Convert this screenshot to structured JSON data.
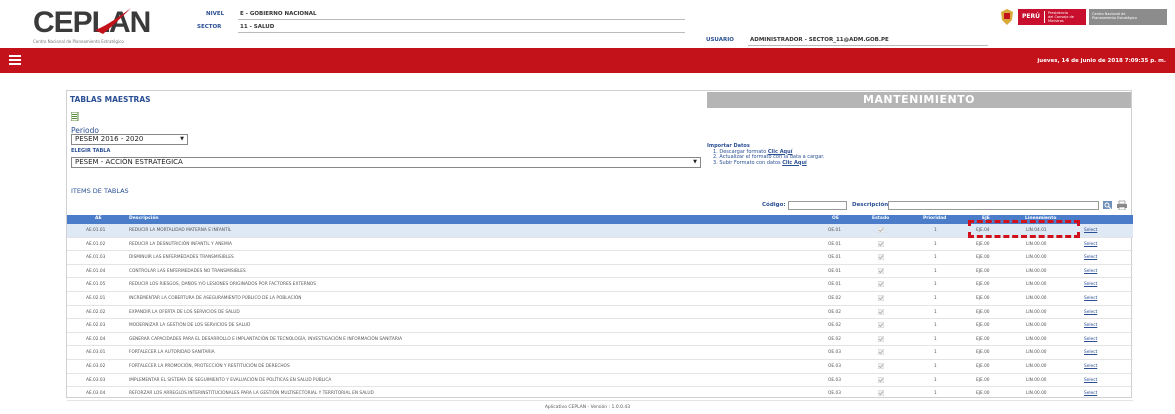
{
  "header": {
    "logo_text": "CEPLAN",
    "logo_sub": "Centro Nacional de Planeamiento Estratégico",
    "nivel_label": "NIVEL",
    "nivel_value": "E - GOBIERNO NACIONAL",
    "sector_label": "SECTOR",
    "sector_value": "11 - SALUD",
    "usuario_label": "USUARIO",
    "usuario_value": "ADMINISTRADOR - SECTOR_11@ADM.GOB.PE",
    "peru_word": "PERÚ",
    "peru_sub": "Presidencia\ndel Consejo de Ministros",
    "ceplan_box": "Centro Nacional de\nPlaneamiento Estratégico"
  },
  "menubar": {
    "datetime": "jueves, 14 de junio de 2018 7:09:35 p. m."
  },
  "panel": {
    "title": "TABLAS MAESTRAS",
    "mant_title": "MANTENIMIENTO",
    "periodo_label": "Periodo",
    "periodo_value": "PESEM 2016 - 2020",
    "elegir_label": "ELEGIR TABLA",
    "tabla_value": "PESEM - ACCIÓN ESTRATÉGICA",
    "import": {
      "title": "Importar Datos",
      "step1": "1. Descargar formato",
      "step1_link": "Clic Aquí",
      "step2": "2. Actualizar el formato con la data a cargar.",
      "step3": "3. Subir Formato con datos",
      "step3_link": "Clic Aquí"
    },
    "items_label": "ITEMS DE TABLAS",
    "codigo_label": "Código:",
    "descripcion_label": "Descripción:"
  },
  "grid": {
    "headers": {
      "ae": "AE",
      "descripcion": "Descripción",
      "oe": "OE",
      "estado": "Estado",
      "prioridad": "Prioridad",
      "eje": "EJE",
      "lineamiento": "Lineamiento"
    },
    "rows": [
      {
        "ae": "AE.01.01",
        "desc": "REDUCIR LA MORTALIDAD MATERNA E INFANTIL",
        "oe": "OE.01",
        "prio": "1",
        "eje": "EJE.04",
        "lin": "LIN.04.01",
        "action": "Select"
      },
      {
        "ae": "AE.01.02",
        "desc": "REDUCIR LA DESNUTRICIÓN INFANTIL Y ANEMIA",
        "oe": "OE.01",
        "prio": "1",
        "eje": "EJE.00",
        "lin": "LIN.00.00",
        "action": "Select"
      },
      {
        "ae": "AE.01.03",
        "desc": "DISMINUIR LAS ENFERMEDADES TRANSMISIBLES",
        "oe": "OE.01",
        "prio": "1",
        "eje": "EJE.00",
        "lin": "LIN.00.00",
        "action": "Select"
      },
      {
        "ae": "AE.01.04",
        "desc": "CONTROLAR LAS ENFERMEDADES NO TRANSMISIBLES",
        "oe": "OE.01",
        "prio": "1",
        "eje": "EJE.00",
        "lin": "LIN.00.00",
        "action": "Select"
      },
      {
        "ae": "AE.01.05",
        "desc": "REDUCIR LOS RIESGOS, DAÑOS Y/O LESIONES ORIGINADOS POR FACTORES EXTERNOS",
        "oe": "OE.01",
        "prio": "1",
        "eje": "EJE.00",
        "lin": "LIN.00.00",
        "action": "Select"
      },
      {
        "ae": "AE.02.01",
        "desc": "INCREMENTAR LA COBERTURA DE ASEGURAMIENTO PÚBLICO DE LA POBLACIÓN",
        "oe": "OE.02",
        "prio": "1",
        "eje": "EJE.00",
        "lin": "LIN.00.00",
        "action": "Select"
      },
      {
        "ae": "AE.02.02",
        "desc": "EXPANDIR LA OFERTA DE LOS SERVICIOS DE SALUD",
        "oe": "OE.02",
        "prio": "1",
        "eje": "EJE.00",
        "lin": "LIN.00.00",
        "action": "Select"
      },
      {
        "ae": "AE.02.03",
        "desc": "MODERNIZAR LA GESTIÓN DE LOS SERVICIOS DE SALUD",
        "oe": "OE.02",
        "prio": "1",
        "eje": "EJE.00",
        "lin": "LIN.00.00",
        "action": "Select"
      },
      {
        "ae": "AE.02.04",
        "desc": "GENERAR CAPACIDADES PARA EL DESARROLLO E IMPLANTACIÓN DE TECNOLOGÍA, INVESTIGACIÓN E INFORMACIÓN SANITARIA",
        "oe": "OE.02",
        "prio": "1",
        "eje": "EJE.00",
        "lin": "LIN.00.00",
        "action": "Select"
      },
      {
        "ae": "AE.03.01",
        "desc": "FORTALECER LA AUTORIDAD SANITARIA",
        "oe": "OE.03",
        "prio": "1",
        "eje": "EJE.00",
        "lin": "LIN.00.00",
        "action": "Select"
      },
      {
        "ae": "AE.03.02",
        "desc": "FORTALECER LA PROMOCIÓN, PROTECCIÓN Y RESTITUCIÓN DE DERECHOS",
        "oe": "OE.03",
        "prio": "1",
        "eje": "EJE.00",
        "lin": "LIN.00.00",
        "action": "Select"
      },
      {
        "ae": "AE.03.03",
        "desc": "IMPLEMENTAR EL SISTEMA DE SEGUIMIENTO Y EVALUACIÓN DE POLÍTICAS EN SALUD PÚBLICA",
        "oe": "OE.03",
        "prio": "1",
        "eje": "EJE.00",
        "lin": "LIN.00.00",
        "action": "Select"
      },
      {
        "ae": "AE.03.04",
        "desc": "REFORZAR LOS ARREGLOS INTERINSTITUCIONALES PARA LA GESTIÓN MULTISECTORIAL Y TERRITORIAL EN SALUD",
        "oe": "OE.03",
        "prio": "1",
        "eje": "EJE.00",
        "lin": "LIN.00.00",
        "action": "Select"
      }
    ]
  },
  "footer": {
    "text": "Aplicativo CEPLAN - Versión : 1.0.0.43"
  },
  "colors": {
    "brand_red": "#c4121b",
    "grid_header": "#4a7cc9",
    "link_blue": "#2a4f93",
    "annotation_red": "#d0101a"
  }
}
